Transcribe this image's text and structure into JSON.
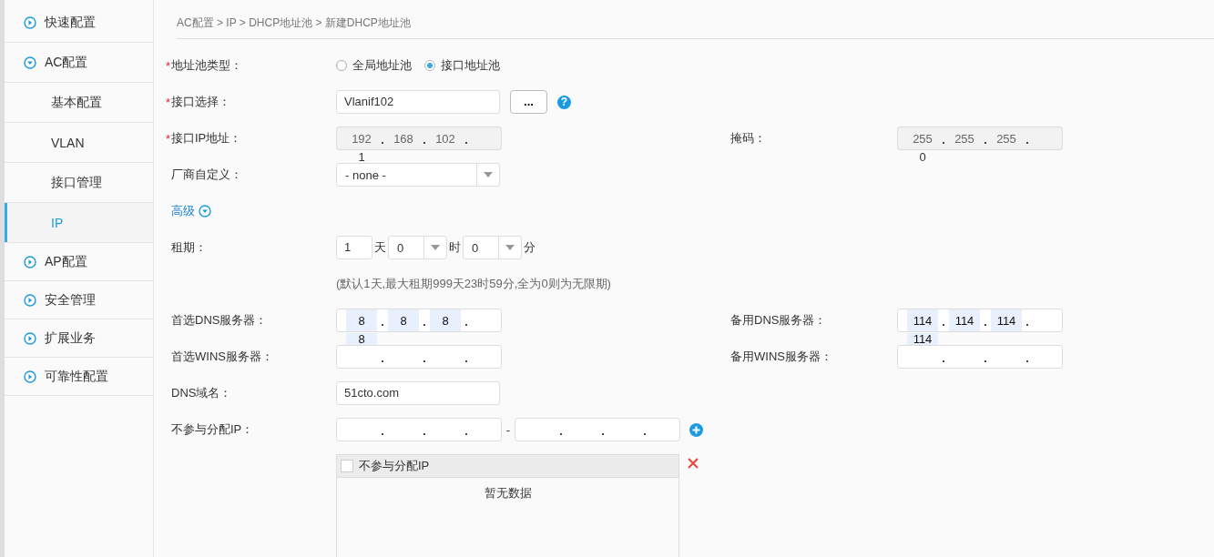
{
  "sidebar": {
    "items": [
      {
        "label": "快速配置",
        "kind": "group",
        "expanded": false,
        "selected": false
      },
      {
        "label": "AC配置",
        "kind": "group",
        "expanded": true,
        "selected": false
      },
      {
        "label": "基本配置",
        "kind": "sub",
        "selected": false
      },
      {
        "label": "VLAN",
        "kind": "sub",
        "selected": false
      },
      {
        "label": "接口管理",
        "kind": "sub",
        "selected": false
      },
      {
        "label": "IP",
        "kind": "sub",
        "selected": true
      },
      {
        "label": "AP配置",
        "kind": "group",
        "expanded": false,
        "selected": false
      },
      {
        "label": "安全管理",
        "kind": "group",
        "expanded": false,
        "selected": false
      },
      {
        "label": "扩展业务",
        "kind": "group",
        "expanded": false,
        "selected": false
      },
      {
        "label": "可靠性配置",
        "kind": "group",
        "expanded": false,
        "selected": false
      }
    ]
  },
  "breadcrumb": "AC配置 > IP > DHCP地址池 > 新建DHCP地址池",
  "form": {
    "pool_type": {
      "required_mark": "*",
      "label": "地址池类型：",
      "options": [
        {
          "label": "全局地址池",
          "selected": false
        },
        {
          "label": "接口地址池",
          "selected": true
        }
      ]
    },
    "interface": {
      "required_mark": "*",
      "label": "接口选择：",
      "value": "Vlanif102",
      "button": "...",
      "help": "?"
    },
    "interface_ip": {
      "required_mark": "*",
      "label": "接口IP地址：",
      "octets": [
        "192",
        "168",
        "102",
        "1"
      ],
      "disabled": true,
      "highlighted": false
    },
    "mask": {
      "label": "掩码：",
      "octets": [
        "255",
        "255",
        "255",
        "0"
      ],
      "disabled": true,
      "highlighted": false
    },
    "vendor": {
      "label": "厂商自定义：",
      "value": "- none -"
    },
    "advanced": {
      "label": "高级",
      "expanded": true
    },
    "lease": {
      "label": "租期：",
      "days": "1",
      "day_unit": "天",
      "hours": "0",
      "hour_unit": "时",
      "minutes": "0",
      "minute_unit": "分",
      "hint": "(默认1天,最大租期999天23时59分,全为0则为无限期)"
    },
    "dns_primary": {
      "label": "首选DNS服务器：",
      "octets": [
        "8",
        "8",
        "8",
        "8"
      ],
      "disabled": false,
      "highlighted": true
    },
    "dns_backup": {
      "label": "备用DNS服务器：",
      "octets": [
        "114",
        "114",
        "114",
        "114"
      ],
      "disabled": false,
      "highlighted": true
    },
    "wins_primary": {
      "label": "首选WINS服务器：",
      "disabled": false
    },
    "wins_backup": {
      "label": "备用WINS服务器：",
      "disabled": false
    },
    "domain": {
      "label": "DNS域名：",
      "value": "51cto.com"
    },
    "exclude": {
      "label": "不参与分配IP：",
      "separator": "-"
    },
    "exclude_table": {
      "column": "不参与分配IP",
      "checked": false,
      "empty_text": "暂无数据"
    }
  }
}
